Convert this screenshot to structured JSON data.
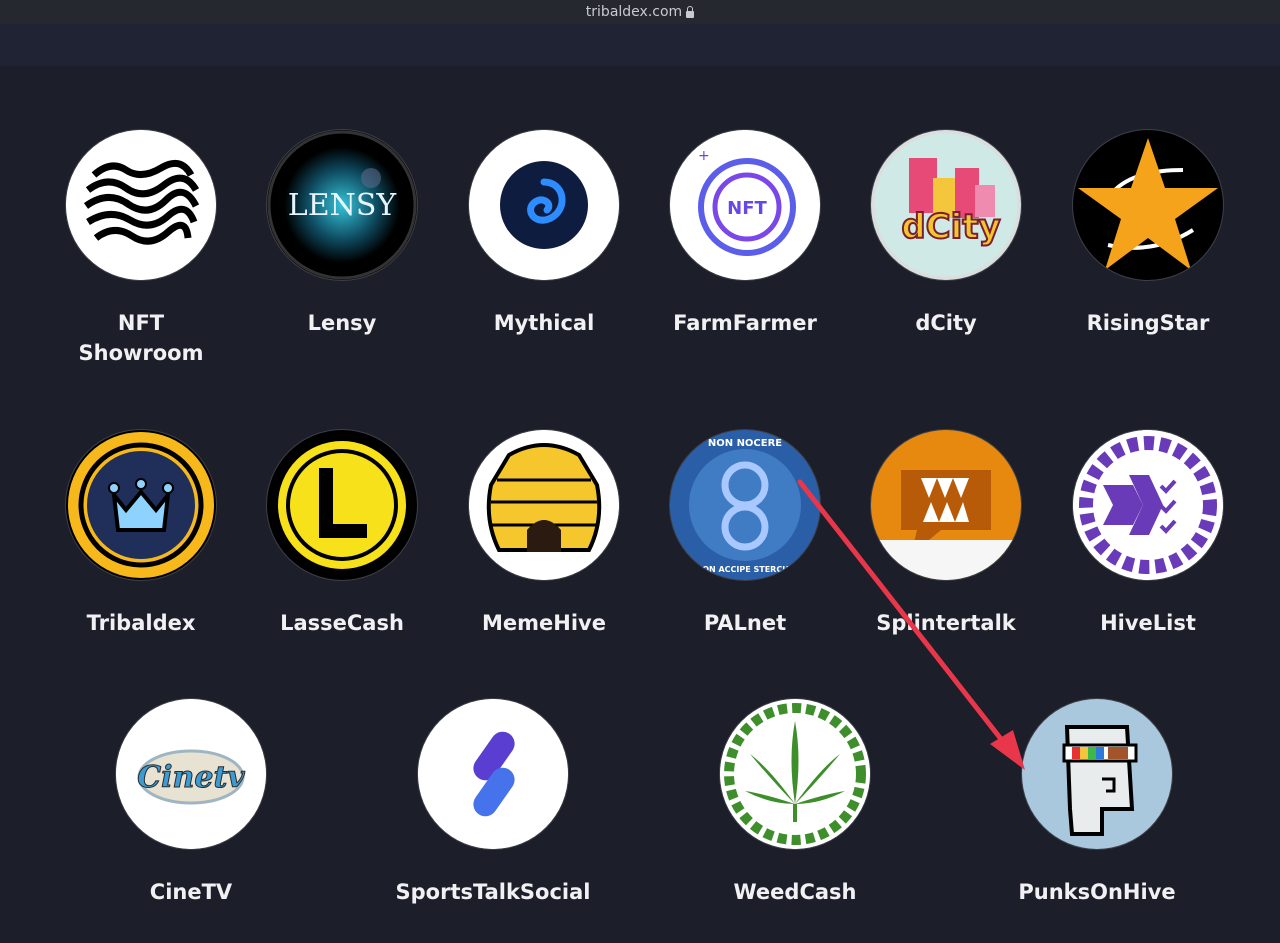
{
  "browser": {
    "url": "tribaldex.com",
    "secure_icon": "lock-icon"
  },
  "apps": [
    {
      "label": "NFT Showroom",
      "icon": "nft-showroom-icon"
    },
    {
      "label": "Lensy",
      "icon": "lensy-icon"
    },
    {
      "label": "Mythical",
      "icon": "mythical-icon"
    },
    {
      "label": "FarmFarmer",
      "icon": "farmfarmer-icon"
    },
    {
      "label": "dCity",
      "icon": "dcity-icon"
    },
    {
      "label": "RisingStar",
      "icon": "risingstar-icon"
    },
    {
      "label": "Tribaldex",
      "icon": "tribaldex-icon"
    },
    {
      "label": "LasseCash",
      "icon": "lassecash-icon"
    },
    {
      "label": "MemeHive",
      "icon": "memehive-icon"
    },
    {
      "label": "PALnet",
      "icon": "palnet-icon"
    },
    {
      "label": "Splintertalk",
      "icon": "splintertalk-icon"
    },
    {
      "label": "HiveList",
      "icon": "hivelist-icon"
    },
    {
      "label": "CineTV",
      "icon": "cinetv-icon"
    },
    {
      "label": "SportsTalkSocial",
      "icon": "sportstalksocial-icon"
    },
    {
      "label": "WeedCash",
      "icon": "weedcash-icon"
    },
    {
      "label": "PunksOnHive",
      "icon": "punksonhive-icon"
    }
  ],
  "icon_text": {
    "lensy": "LENSY",
    "farmfarmer": "NFT",
    "dcity": "dCity",
    "palnet_top": "NON NOCERE",
    "palnet_bottom": "NON ACCIPE STERCUS",
    "cinetv": "Cinetv"
  },
  "colors": {
    "background": "#1c1e29",
    "label": "#f1f1f4",
    "annotation_arrow": "#e8374a",
    "risingstar": "#f4a31a",
    "lassecash": "#f6e11a",
    "weedcash": "#3f8e2c",
    "hivelist": "#6a3bb8"
  }
}
